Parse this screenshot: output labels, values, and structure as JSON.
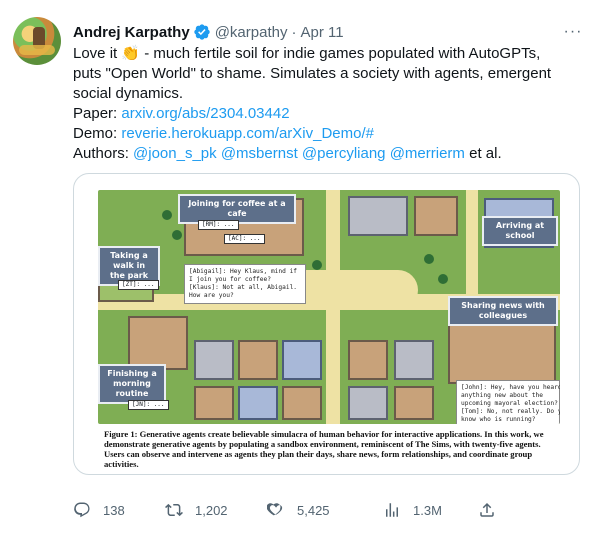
{
  "tweet": {
    "author_name": "Andrej Karpathy",
    "handle": "@karpathy",
    "separator": "·",
    "date": "Apr 11",
    "more_icon": "ellipsis-icon",
    "lines": {
      "l1a": "Love it ",
      "l1b": " - much fertile soil for indie games populated with AutoGPTs,",
      "l2": "puts \"Open World\" to shame. Simulates a society with agents, emergent",
      "l3": "social dynamics."
    },
    "clap_emoji": "👏",
    "paper_label": "Paper: ",
    "paper_link": "arxiv.org/abs/2304.03442",
    "demo_label": "Demo: ",
    "demo_link": "reverie.herokuapp.com/arXiv_Demo/#",
    "authors_label": "Authors: ",
    "authors": [
      "@joon_s_pk",
      "@msbernst",
      "@percyliang",
      "@merrierm"
    ],
    "authors_suffix": " et al.",
    "accent_color": "#1d9bf0"
  },
  "figure": {
    "labels": {
      "coffee": "Joining for coffee at a cafe",
      "walk": "Taking a walk in the park",
      "school": "Arriving at school",
      "colleagues": "Sharing news with colleagues",
      "morning": "Finishing a morning routine"
    },
    "bubbles": {
      "cafe1": "[RM]: ...",
      "cafe2": "[AC]: ...",
      "park": "[ZT]: ...",
      "morning": "[JN]: ..."
    },
    "dialog_cafe": [
      "[Abigail]: Hey Klaus, mind if",
      "I join you for coffee?",
      "[Klaus]: Not at all, Abigail.",
      "How are you?"
    ],
    "dialog_news": [
      "[John]: Hey, have you heard",
      "anything new about the",
      "upcoming mayoral election?",
      "[Tom]: No, not really. Do you",
      "know who is running?"
    ],
    "caption_bold": "Figure 1: Generative agents create believable simulacra of human behavior for interactive applications. In this work, we demonstrate generative agents by populating a sandbox environment, reminiscent of The Sims, with twenty-five agents. Users can observe and intervene as agents they plan their days, share news, form relationships, and coordinate group activities."
  },
  "actions": {
    "replies": "138",
    "retweets": "1,202",
    "likes": "5,425",
    "views": "1.3M",
    "icons": [
      "reply-icon",
      "retweet-icon",
      "like-icon",
      "views-icon",
      "share-icon"
    ]
  }
}
